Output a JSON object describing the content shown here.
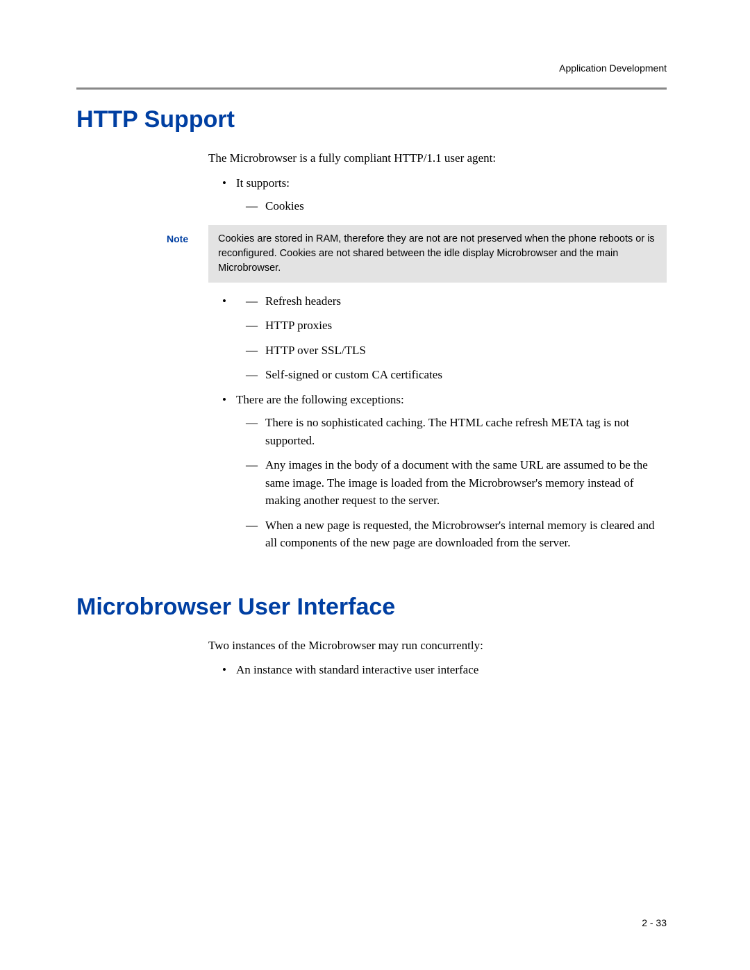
{
  "header": {
    "section": "Application Development"
  },
  "h1": "HTTP Support",
  "intro": "The Microbrowser is a fully compliant HTTP/1.1 user agent:",
  "supports_label": "It supports:",
  "supports": {
    "cookies": "Cookies",
    "refresh": "Refresh headers",
    "proxies": "HTTP proxies",
    "ssl": "HTTP over SSL/TLS",
    "certs": "Self-signed or custom CA certificates"
  },
  "note": {
    "label": "Note",
    "body": "Cookies are stored in RAM, therefore they are not are not preserved when the phone reboots or is reconfigured. Cookies are not shared between the idle display Microbrowser and the main Microbrowser."
  },
  "exceptions_label": "There are the following exceptions:",
  "exceptions": {
    "e1": "There is no sophisticated caching. The HTML cache refresh META tag is not supported.",
    "e2": "Any images in the body of a document with the same URL are assumed to be the same image. The image is loaded from the Microbrowser's memory instead of making another request to the server.",
    "e3": "When a new page is requested, the Microbrowser's internal memory is cleared and all components of the new page are downloaded from the server."
  },
  "h2": "Microbrowser User Interface",
  "mui_intro": "Two instances of the Microbrowser may run concurrently:",
  "mui_item1": "An instance with standard interactive user interface",
  "page_number": "2 - 33"
}
